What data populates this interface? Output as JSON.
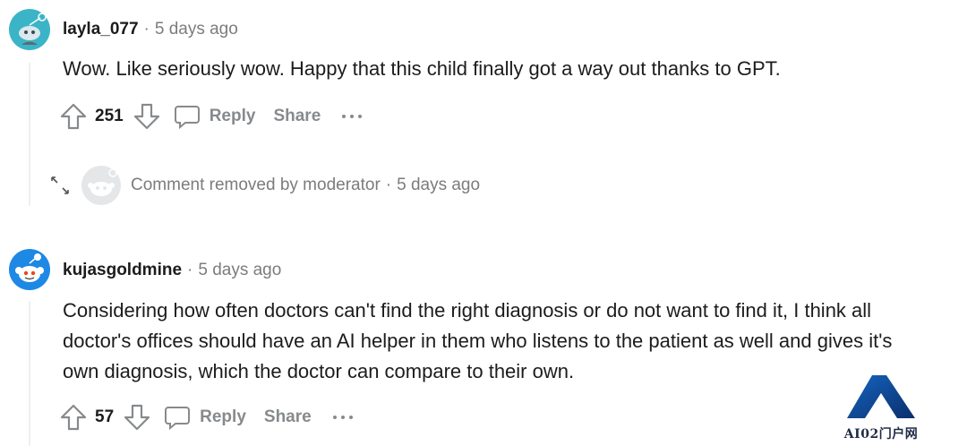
{
  "comments": [
    {
      "author": "layla_077",
      "separator": "·",
      "time": "5 days ago",
      "lines": [
        "Wow. Like seriously wow. Happy that this child finally got a way out thanks to GPT."
      ],
      "score": "251",
      "reply_label": "Reply",
      "share_label": "Share"
    },
    {
      "author": "kujasgoldmine",
      "separator": "·",
      "time": "5 days ago",
      "lines": [
        "Considering how often doctors can't find the right diagnosis or do not want to find it, I think all",
        "doctor's offices should have an AI helper in them who listens to the patient as well and gives it's",
        "own diagnosis, which the doctor can compare to their own."
      ],
      "score": "57",
      "reply_label": "Reply",
      "share_label": "Share"
    }
  ],
  "removed_comment": {
    "text": "Comment removed by moderator",
    "separator": "·",
    "time": "5 days ago"
  },
  "watermark": {
    "text": "AI02门户网"
  },
  "colors": {
    "teal_avatar": "#3bb4c8",
    "blue_avatar": "#1e88e5",
    "muted": "#878a8c",
    "thread_line": "#edeff1"
  }
}
